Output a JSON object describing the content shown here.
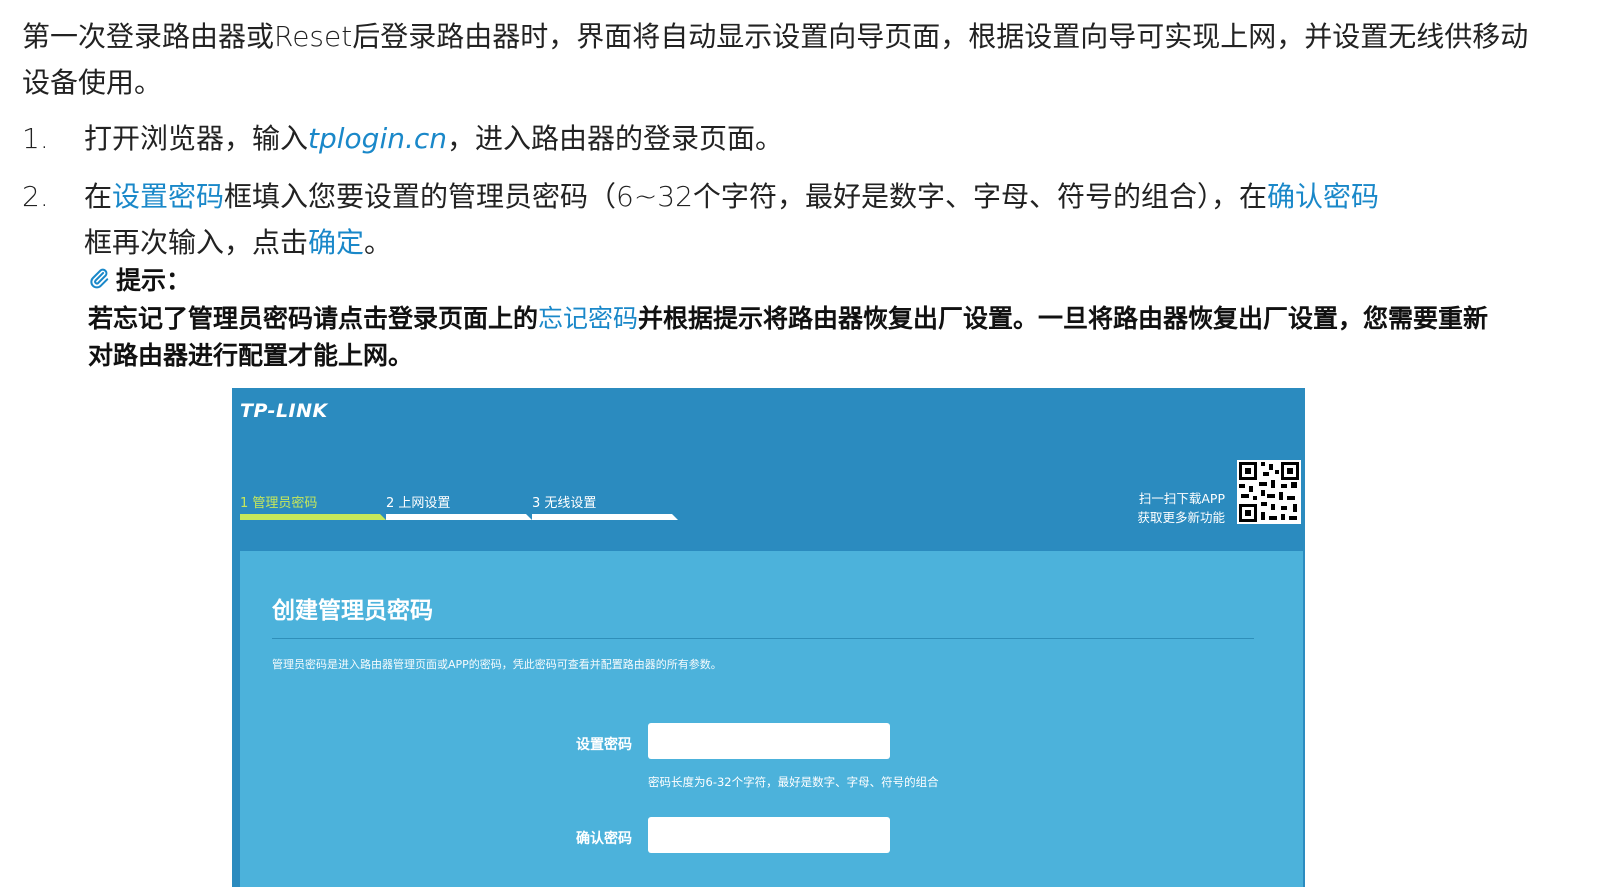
{
  "intro": {
    "text": "第一次登录路由器或Reset后登录路由器时，界面将自动显示设置向导页面，根据设置向导可实现上网，并设置无线供移动设备使用。"
  },
  "steps": [
    {
      "number": "1.",
      "before": "打开浏览器，输入",
      "link": "tplogin.cn",
      "after": "，进入路由器的登录页面。"
    },
    {
      "number": "2.",
      "part1": "在",
      "link1": "设置密码",
      "part2": "框填入您要设置的管理员密码（6~32个字符，最好是数字、字母、符号的组合），在",
      "link2": "确认密码",
      "part3": "框再次输入，点击",
      "link3": "确定",
      "part4": "。"
    }
  ],
  "note": {
    "icon": "paperclip-icon",
    "title": "提示：",
    "before": "若忘记了管理员密码请点击登录页面上的",
    "link": "忘记密码",
    "after": "并根据提示将路由器恢复出厂设置。一旦将路由器恢复出厂设置，您需要重新对路由器进行配置才能上网。"
  },
  "router": {
    "logo": "TP-LINK",
    "tabs": [
      {
        "label": "1 管理员密码",
        "active": true
      },
      {
        "label": "2 上网设置",
        "active": false
      },
      {
        "label": "3 无线设置",
        "active": false
      }
    ],
    "qr_line1": "扫一扫下载APP",
    "qr_line2": "获取更多新功能",
    "panel_title": "创建管理员密码",
    "panel_desc": "管理员密码是进入路由器管理页面或APP的密码，凭此密码可查看并配置路由器的所有参数。",
    "set_password_label": "设置密码",
    "password_hint": "密码长度为6-32个字符，最好是数字、字母、符号的组合",
    "confirm_password_label": "确认密码",
    "colors": {
      "header": "#2b8bbf",
      "panel": "#4cb2db",
      "active_tab": "#c7e85a",
      "link": "#1a88c9"
    }
  }
}
